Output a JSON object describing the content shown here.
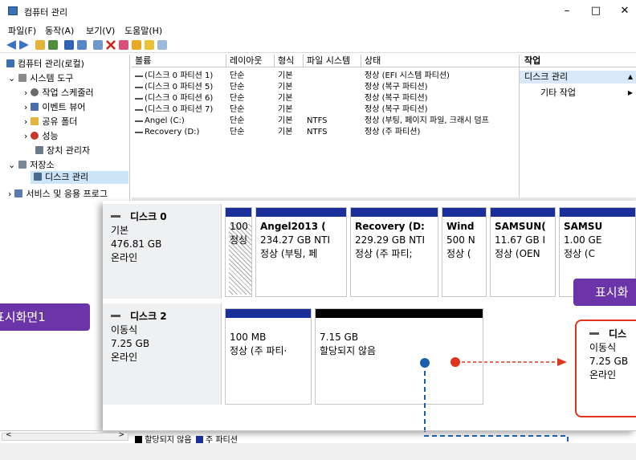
{
  "window": {
    "title": "컴퓨터 관리",
    "minimize": "–",
    "maximize": "□",
    "close": "✕"
  },
  "menu": [
    "파일(F)",
    "동작(A)",
    "보기(V)",
    "도움말(H)"
  ],
  "tree": {
    "root": "컴퓨터 관리(로컬)",
    "system_tools": "시스템 도구",
    "task_scheduler": "작업 스케줄러",
    "event_viewer": "이벤트 뷰어",
    "shared_folders": "공유 폴더",
    "performance": "성능",
    "device_manager": "장치 관리자",
    "storage": "저장소",
    "disk_management": "디스크 관리",
    "services": "서비스 및 응용 프로그"
  },
  "volume_list": {
    "headers": [
      "볼륨",
      "레이아웃",
      "형식",
      "파일 시스템",
      "상태"
    ],
    "rows": [
      [
        "(디스크 0 파티션 1)",
        "단순",
        "기본",
        "",
        "정상 (EFI 시스템 파티션)"
      ],
      [
        "(디스크 0 파티션 5)",
        "단순",
        "기본",
        "",
        "정상 (복구 파티션)"
      ],
      [
        "(디스크 0 파티션 6)",
        "단순",
        "기본",
        "",
        "정상 (복구 파티션)"
      ],
      [
        "(디스크 0 파티션 7)",
        "단순",
        "기본",
        "",
        "정상 (복구 파티션)"
      ],
      [
        "Angel (C:)",
        "단순",
        "기본",
        "NTFS",
        "정상 (부팅, 페이지 파일, 크래시 덤프"
      ],
      [
        "Recovery (D:)",
        "단순",
        "기본",
        "NTFS",
        "정상 (주 파티션)"
      ]
    ]
  },
  "actions": {
    "header": "작업",
    "section": "디스크 관리",
    "more": "기타 작업",
    "expand_glyph": "▲",
    "more_glyph": "▶"
  },
  "disk0": {
    "name": "디스크 0",
    "type": "기본",
    "size": "476.81 GB",
    "status": "온라인",
    "partitions": [
      {
        "line1": "",
        "line2": "100",
        "line3": "정싱"
      },
      {
        "line1": "Angel2013  (",
        "line2": "234.27 GB NTI",
        "line3": "정상 (부팅, 페"
      },
      {
        "line1": "Recovery  (D:",
        "line2": "229.29 GB NTI",
        "line3": "정상 (주 파티;"
      },
      {
        "line1": "Wind",
        "line2": "500 N",
        "line3": "정상 ("
      },
      {
        "line1": "SAMSUN(",
        "line2": "11.67 GB I",
        "line3": "정상 (OEN"
      },
      {
        "line1": "SAMSU",
        "line2": "1.00 GE",
        "line3": "정상 (C"
      }
    ]
  },
  "disk2": {
    "name": "디스크 2",
    "type": "이동식",
    "size": "7.25 GB",
    "status": "온라인",
    "partitions": [
      {
        "line1": "100 MB",
        "line2": "정상 (주 파티·"
      },
      {
        "line1": "7.15 GB",
        "line2": "할당되지 않음"
      }
    ]
  },
  "legend": {
    "unallocated": "할당되지 않음",
    "primary": "주 파티션"
  },
  "callout_left": "표시화면1",
  "callout_right": "표시화",
  "zoom_box": {
    "name": "디스",
    "type": "이동식",
    "size": "7.25 GB",
    "status": "온라인"
  },
  "scroll_left": "<",
  "scroll_right": ">",
  "colors": {
    "primary": "#1b2f99",
    "unallocated": "#000000",
    "callout": "#6b34a8",
    "red": "#e0341c",
    "blue": "#1b5fb0"
  }
}
